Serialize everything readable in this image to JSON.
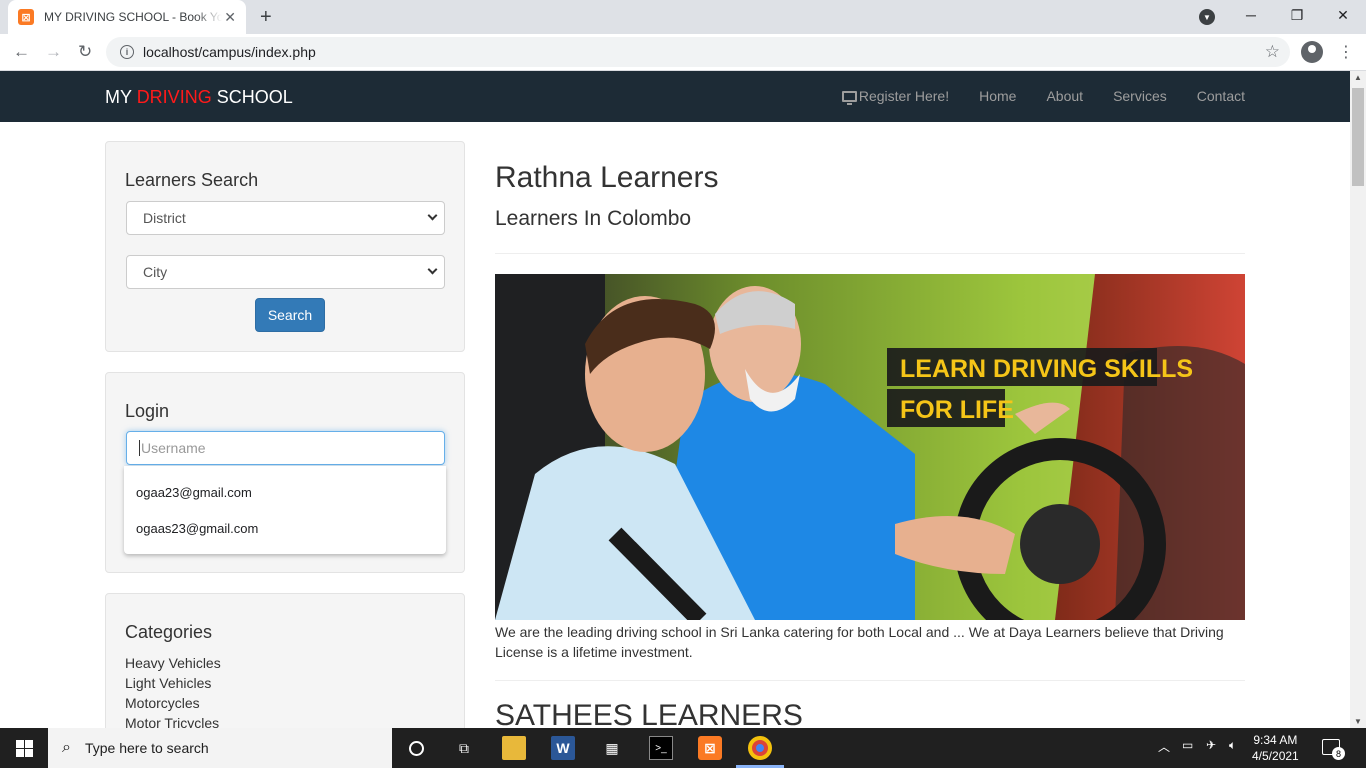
{
  "browser": {
    "tab_title": "MY DRIVING SCHOOL - Book Your Driving School",
    "url": "localhost/campus/index.php",
    "new_tab_symbol": "+",
    "tab_close_symbol": "✕"
  },
  "navbar": {
    "brand_part1": "MY ",
    "brand_part2": "DRIVING",
    "brand_part3": " SCHOOL",
    "register_label": "Register Here!",
    "links": [
      "Home",
      "About",
      "Services",
      "Contact"
    ]
  },
  "search_panel": {
    "title": "Learners Search",
    "district_placeholder": "District",
    "city_placeholder": "City",
    "button_label": "Search"
  },
  "login_panel": {
    "title": "Login",
    "username_placeholder": "Username",
    "suggestions": [
      "ogaa23@gmail.com",
      "ogaas23@gmail.com"
    ]
  },
  "categories_panel": {
    "title": "Categories",
    "items": [
      "Heavy Vehicles",
      "Light Vehicles",
      "Motorcycles",
      "Motor Tricycles"
    ]
  },
  "main": {
    "school1_title": "Rathna Learners",
    "school1_subtitle": "Learners In Colombo",
    "hero_line1": "LEARN DRIVING SKILLS",
    "hero_line2": "FOR LIFE",
    "description": "We are the leading driving school in Sri Lanka catering for both Local and ... We at Daya Learners believe that Driving License is a lifetime investment.",
    "school2_title": "SATHEES LEARNERS"
  },
  "taskbar": {
    "search_placeholder": "Type here to search",
    "time": "9:34 AM",
    "date": "4/5/2021",
    "notification_count": "8"
  },
  "colors": {
    "navbar_bg": "#1d2b36",
    "brand_accent": "#ff1a1a",
    "primary_button": "#337ab7",
    "hero_banner_text": "#f5c518"
  }
}
